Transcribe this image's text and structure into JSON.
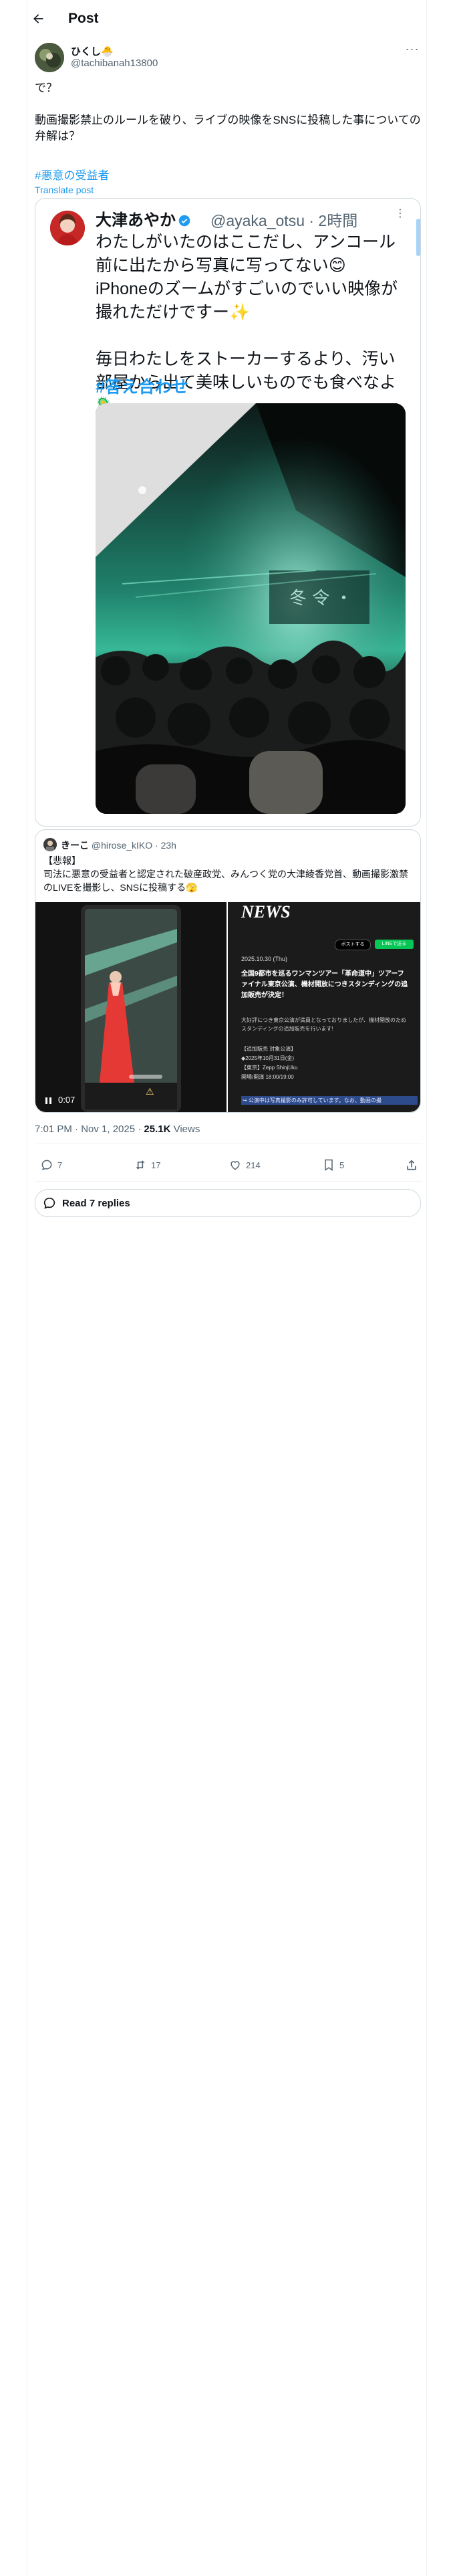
{
  "header": {
    "title": "Post"
  },
  "author": {
    "name": "ひくし🐣",
    "handle": "@tachibanah13800"
  },
  "post": {
    "line1": "で？",
    "line2": "動画撮影禁止のルールを破り、ライブの映像をSNSに投稿した事についての弁解は？",
    "hashtag": "#悪意の受益者",
    "translate": "Translate post"
  },
  "quote": {
    "name": "大津あやか",
    "handle": "@ayaka_otsu · 2時間",
    "body_line1": "わたしがいたのはここだし、アンコール前に出たから写真に写ってない😊",
    "body_line2": "iPhoneのズームがすごいのでいい映像が撮れただけですー✨",
    "body_line3": "毎日わたしをストーカーするより、汚い部屋から出て美味しいものでも食べなよ🦠",
    "hashtag": "#答え合わせ"
  },
  "quote2": {
    "name": "きーこ",
    "handle": "@hirose_kIKO · 23h",
    "text": "【悲報】\n司法に悪意の受益者と認定された破産政党、みんつく党の大津綾香党首、動画撮影激禁のLIVEを撮影し、SNSに投稿する🫣",
    "video_time": "0:07",
    "news_title": "NEWS",
    "news_date": "2025.10.30 (Thu)",
    "news_headline": "全国9都市を巡るワンマンツアー「革命道中」ツアーファイナル東京公演、機材開放につきスタンディングの追加販売が決定！",
    "news_body": "大好評につき東京公演が満員となっておりましたが、機材開放のため スタンディングの追加販売を行います!",
    "news_detail1": "【追加販売 対象公演】",
    "news_detail2": "◆2025年10月31日(金)",
    "news_detail3": "【東京】Zepp ShinjUku",
    "news_detail4": "開場/開演 18:00/19:00",
    "news_caption": "↪ 公演中は写真撮影のみ許可しています。なお、動画の撮",
    "post_btn": "ポストする",
    "line_btn": "LINEで送る"
  },
  "meta": {
    "time": "7:01 PM · Nov 1, 2025 · ",
    "views_count": "25.1K",
    "views_label": " Views"
  },
  "actions": {
    "replies": "7",
    "reposts": "17",
    "likes": "214",
    "bookmarks": "5"
  },
  "replies_button": "Read 7 replies",
  "colors": {
    "link": "#1d9bf0",
    "muted": "#536471",
    "border": "#cfd9de"
  },
  "icons": [
    "back-arrow-icon",
    "more-icon",
    "verified-icon",
    "reply-icon",
    "repost-icon",
    "like-icon",
    "bookmark-icon",
    "share-icon",
    "speech-bubble-icon",
    "pause-icon"
  ]
}
